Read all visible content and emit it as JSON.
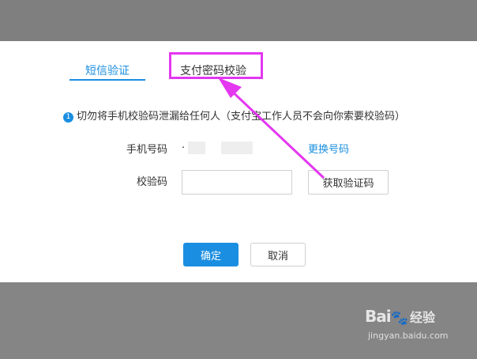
{
  "tabs": {
    "sms": "短信验证",
    "password": "支付密码校验"
  },
  "notice": {
    "icon": "1",
    "text": "切勿将手机校验码泄漏给任何人（支付宝工作人员不会向你索要校验码）"
  },
  "form": {
    "phone_label": "手机号码",
    "phone_value": ".",
    "change_link": "更换号码",
    "code_label": "校验码",
    "code_value": "",
    "get_code_button": "获取验证码"
  },
  "actions": {
    "confirm": "确定",
    "cancel": "取消"
  },
  "watermark": {
    "logo": "Bai",
    "logo_suffix": "经验",
    "url": "jingyan.baidu.com"
  },
  "colors": {
    "accent": "#1a8ee1",
    "annotation": "#e337f0"
  }
}
